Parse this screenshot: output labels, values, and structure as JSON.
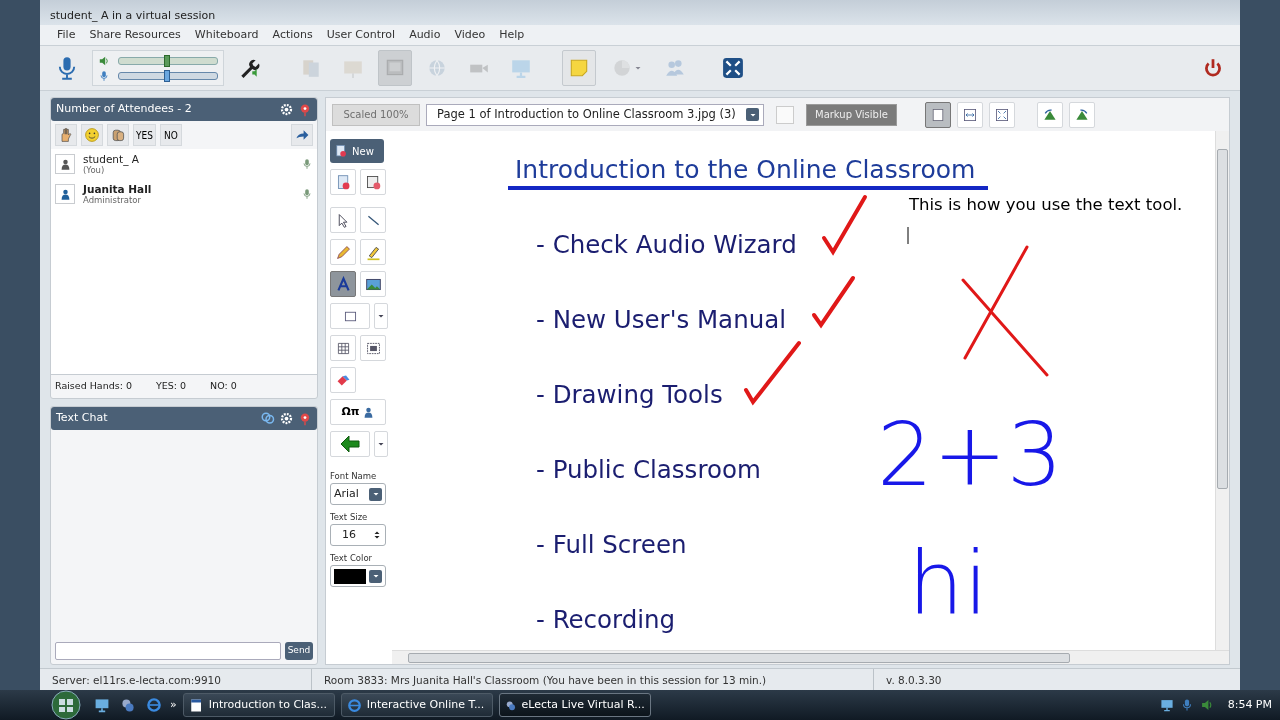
{
  "window": {
    "title": "student_ A in a virtual session"
  },
  "menu": [
    {
      "label": "File"
    },
    {
      "label": "Share Resources"
    },
    {
      "label": "Whiteboard"
    },
    {
      "label": "Actions"
    },
    {
      "label": "User Control"
    },
    {
      "label": "Audio"
    },
    {
      "label": "Video"
    },
    {
      "label": "Help"
    }
  ],
  "toolbar": {
    "speaker_slider": {
      "level": 0.49
    },
    "mic_slider": {
      "level": 0.49
    },
    "buttons": [
      {
        "kind": "documents",
        "disabled": true,
        "selected": false
      },
      {
        "kind": "presentation",
        "disabled": true,
        "selected": false
      },
      {
        "kind": "whiteboard",
        "disabled": true,
        "selected": true
      },
      {
        "kind": "globe",
        "disabled": true,
        "selected": false
      },
      {
        "kind": "camera",
        "disabled": true,
        "selected": false
      },
      {
        "kind": "screen",
        "disabled": true,
        "selected": false
      },
      {
        "kind": "note",
        "disabled": false,
        "selected": true
      },
      {
        "kind": "pie",
        "disabled": true,
        "selected": false
      },
      {
        "kind": "users",
        "disabled": true,
        "selected": false
      },
      {
        "kind": "fullscreen",
        "disabled": false,
        "selected": false
      }
    ]
  },
  "attendees": {
    "title": "Number of Attendees - 2",
    "yes": "YES",
    "no": "NO",
    "people": [
      {
        "name": "student_ A",
        "role": "(You)",
        "admin": false
      },
      {
        "name": "Juanita Hall",
        "role": "Administrator",
        "admin": true
      }
    ],
    "footer": [
      "Raised Hands: 0",
      "YES: 0",
      "NO: 0"
    ]
  },
  "chat": {
    "title": "Text Chat",
    "send": "Send"
  },
  "whiteboard": {
    "scale": {
      "label": "Scaled 100%",
      "disabled": true
    },
    "page": "Page 1 of Introduction to Online Classroom 3.jpg (3)",
    "markup_checked": false,
    "markup": "Markup Visible",
    "new": "New",
    "tools": [
      [
        {
          "kind": "import",
          "selected": false
        },
        {
          "kind": "clear",
          "selected": false
        }
      ],
      [
        {
          "kind": "select",
          "selected": false
        },
        {
          "kind": "line",
          "selected": false
        }
      ],
      [
        {
          "kind": "pencil",
          "selected": false
        },
        {
          "kind": "highlighter",
          "selected": false
        }
      ],
      [
        {
          "kind": "text",
          "selected": true
        },
        {
          "kind": "image",
          "selected": false
        }
      ],
      [
        {
          "kind": "rect",
          "selected": false
        }
      ],
      [
        {
          "kind": "grid",
          "selected": false
        },
        {
          "kind": "capture",
          "selected": false
        }
      ],
      [
        {
          "kind": "eraser",
          "selected": false
        }
      ],
      [
        {
          "kind": "symbols",
          "label": "Ωπ",
          "selected": false
        }
      ],
      [
        {
          "kind": "arrow",
          "selected": false
        }
      ]
    ],
    "font": {
      "label": "Font Name",
      "value": "Arial"
    },
    "size": {
      "label": "Text Size",
      "value": "16"
    },
    "color": {
      "label": "Text Color",
      "color": "#000000"
    },
    "slide": {
      "title": "Introduction to the Online Classroom",
      "items": [
        "- Check Audio Wizard",
        "- New User's Manual",
        "- Drawing Tools",
        "- Public Classroom",
        "- Full Screen",
        "- Recording"
      ]
    },
    "typed_text": "This is how you use the text tool.",
    "handwriting": [
      "2+3",
      "hi"
    ]
  },
  "status_bar": [
    "Server: el11rs.e-lecta.com:9910",
    "Room 3833: Mrs Juanita Hall's Classroom (You have been in this session for 13 min.)",
    "v. 8.0.3.30"
  ],
  "taskbar": {
    "more": "»",
    "tasks": [
      {
        "label": "Introduction to Clas...",
        "kind": "word",
        "selected": false
      },
      {
        "label": "Interactive Online T...",
        "kind": "browser",
        "selected": false
      },
      {
        "label": "eLecta Live Virtual R...",
        "kind": "app",
        "selected": true
      }
    ],
    "clock": "8:54 PM"
  }
}
